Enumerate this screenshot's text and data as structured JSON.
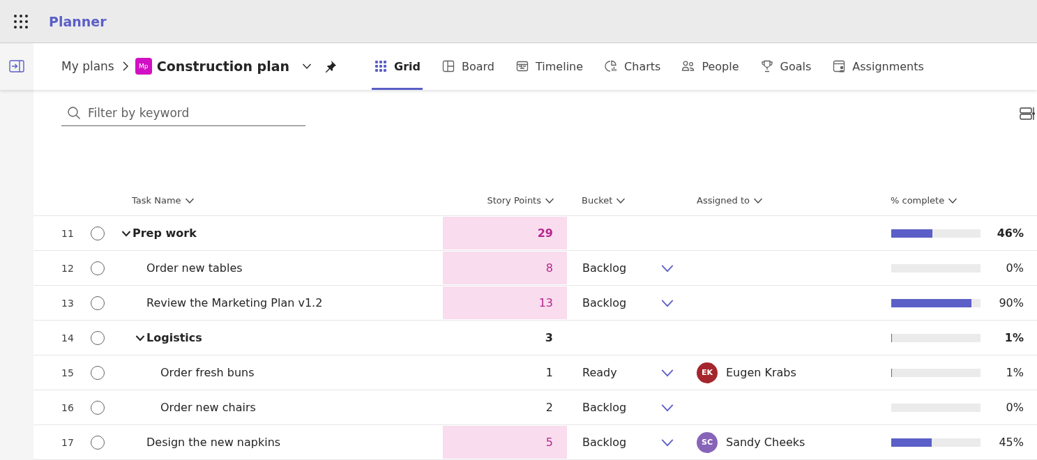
{
  "app_bar": {
    "title": "Planner"
  },
  "breadcrumb": {
    "root": "My plans",
    "plan_badge": "Mp",
    "plan_name": "Construction plan"
  },
  "tabs": [
    {
      "label": "Grid",
      "selected": true
    },
    {
      "label": "Board",
      "selected": false
    },
    {
      "label": "Timeline",
      "selected": false
    },
    {
      "label": "Charts",
      "selected": false
    },
    {
      "label": "People",
      "selected": false
    },
    {
      "label": "Goals",
      "selected": false
    },
    {
      "label": "Assignments",
      "selected": false
    }
  ],
  "filter": {
    "placeholder": "Filter by keyword"
  },
  "table": {
    "columns": [
      "Task Name",
      "Story Points",
      "Bucket",
      "Assigned to",
      "% complete"
    ],
    "rows": [
      {
        "number": "11",
        "kind": "summary",
        "name": "Prep work",
        "points": "29",
        "highlighted": true,
        "expanded": true,
        "level": 0.46,
        "percent": "46%",
        "children": [
          {
            "number": "12",
            "kind": "task",
            "name": "Order new tables",
            "points": "8",
            "highlighted": true,
            "bucket": "Backlog",
            "level": 0,
            "percent": "0%"
          },
          {
            "number": "13",
            "kind": "task",
            "name": "Review the Marketing Plan v1.2",
            "points": "13",
            "highlighted": true,
            "bucket": "Backlog",
            "level": 0.9,
            "percent": "90%"
          },
          {
            "number": "14",
            "kind": "summary",
            "name": "Logistics",
            "points": "3",
            "highlighted": false,
            "expanded": true,
            "level": 0.01,
            "percent": "1%",
            "children": [
              {
                "number": "15",
                "kind": "task",
                "name": "Order fresh buns",
                "points": "1",
                "highlighted": false,
                "bucket": "Ready",
                "assignee": {
                  "initials": "EK",
                  "name": "Eugen Krabs",
                  "color": "#a4262c"
                },
                "level": 0.01,
                "percent": "1%"
              },
              {
                "number": "16",
                "kind": "task",
                "name": "Order new chairs",
                "points": "2",
                "highlighted": false,
                "bucket": "Backlog",
                "level": 0,
                "percent": "0%"
              }
            ]
          },
          {
            "number": "17",
            "kind": "task",
            "name": "Design the new napkins",
            "points": "5",
            "highlighted": true,
            "bucket": "Backlog",
            "assignee": {
              "initials": "SC",
              "name": "Sandy Cheeks",
              "color": "#8764b8"
            },
            "level": 0.45,
            "percent": "45%"
          }
        ]
      }
    ]
  }
}
